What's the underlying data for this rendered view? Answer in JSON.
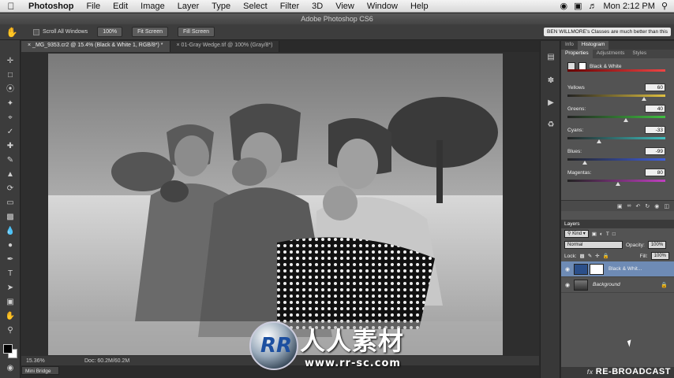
{
  "menubar": {
    "app": "Photoshop",
    "items": [
      "File",
      "Edit",
      "Image",
      "Layer",
      "Type",
      "Select",
      "Filter",
      "3D",
      "View",
      "Window",
      "Help"
    ],
    "clock": "Mon 2:12 PM"
  },
  "window_title": "Adobe Photoshop CS6",
  "options": {
    "scroll_all": "Scroll All Windows",
    "btn_100": "100%",
    "btn_fit": "Fit Screen",
    "btn_fill": "Fill Screen",
    "ticker": "BEN WILLMORE's Classes are much better than this"
  },
  "tabs": [
    {
      "label": "_MG_9353.cr2 @ 15.4% (Black & White 1, RGB/8*) *"
    },
    {
      "label": "01-Gray Wedge.tif @ 100% (Gray/8*)"
    }
  ],
  "status": {
    "zoom": "15.36%",
    "doc": "Doc: 60.2M/60.2M"
  },
  "mini_bridge": "Mini Bridge",
  "panel_tabs_top": [
    "Info",
    "Histogram"
  ],
  "panel_tabs_props": [
    "Properties",
    "Adjustments",
    "Styles"
  ],
  "adjustment_title": "Black & White",
  "sliders": [
    {
      "label": "Yellows",
      "value": "60",
      "fraction": 0.78
    },
    {
      "label": "Greens:",
      "value": "40",
      "fraction": 0.6
    },
    {
      "label": "Cyans:",
      "value": "-33",
      "fraction": 0.32
    },
    {
      "label": "Blues:",
      "value": "-99",
      "fraction": 0.18
    },
    {
      "label": "Magentas:",
      "value": "80",
      "fraction": 0.52
    }
  ],
  "slider_colors": [
    "#e0c040",
    "#40c040",
    "#40c0c0",
    "#4060e0",
    "#c040c0"
  ],
  "layers": {
    "title": "Layers",
    "kind": "Kind",
    "blend": "Normal",
    "opacity_label": "Opacity:",
    "opacity": "100%",
    "lock_label": "Lock:",
    "fill_label": "Fill:",
    "fill": "100%",
    "items": [
      {
        "name": "Black & Whit...",
        "selected": true
      },
      {
        "name": "Background",
        "selected": false
      }
    ]
  },
  "rebroadcast": "RE-BROADCAST",
  "watermark": {
    "logo": "RR",
    "cn": "人人素材",
    "url": "www.rr-sc.com"
  }
}
